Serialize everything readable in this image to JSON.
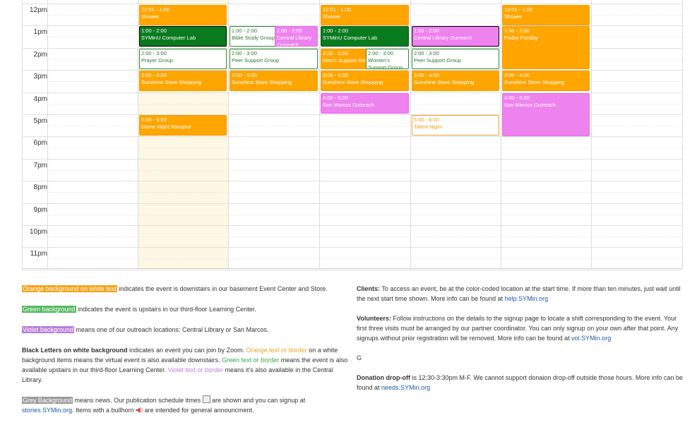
{
  "calendar": {
    "hours": [
      "12pm",
      "1pm",
      "2pm",
      "3pm",
      "4pm",
      "5pm",
      "6pm",
      "7pm",
      "8pm",
      "9pm",
      "10pm",
      "11pm"
    ],
    "events": [
      {
        "id": "e1",
        "day": 1,
        "cls": "orange",
        "time": "12:01 - 1:00",
        "name": "Shower"
      },
      {
        "id": "e2",
        "day": 1,
        "cls": "green",
        "time": "1:00 - 2:00",
        "name": "SYMinU Computer Lab"
      },
      {
        "id": "e3",
        "day": 1,
        "cls": "wgreen",
        "time": "2:00 - 3:00",
        "name": "Prayer Group"
      },
      {
        "id": "e4",
        "day": 1,
        "cls": "orange",
        "time": "3:00 - 4:00",
        "name": "Sunshine Store Shopping"
      },
      {
        "id": "e5",
        "day": 1,
        "cls": "orange",
        "time": "5:00 - 6:00",
        "name": "Game Night Hangout"
      },
      {
        "id": "e6",
        "day": 2,
        "cls": "wgreen",
        "time": "1:00 - 2:00",
        "name": "Bible Study Group"
      },
      {
        "id": "e7",
        "day": 2,
        "cls": "violet",
        "time": "1:00 - 2:00",
        "name": "Central Library Outreach"
      },
      {
        "id": "e8",
        "day": 2,
        "cls": "wgreen",
        "time": "2:00 - 3:00",
        "name": "Peer Support Group"
      },
      {
        "id": "e9",
        "day": 2,
        "cls": "orange",
        "time": "3:00 - 4:00",
        "name": "Sunshine Store Shopping"
      },
      {
        "id": "e10",
        "day": 3,
        "cls": "orange",
        "time": "12:01 - 1:00",
        "name": "Shower"
      },
      {
        "id": "e11",
        "day": 3,
        "cls": "green",
        "time": "1:00 - 2:00",
        "name": "SYMinU Computer Lab"
      },
      {
        "id": "e12",
        "day": 3,
        "cls": "orange",
        "time": "2:00 - 3:00",
        "name": "Men's Support Group"
      },
      {
        "id": "e13",
        "day": 3,
        "cls": "wgreen",
        "time": "2:00 - 3:00",
        "name": "Women's Support Group"
      },
      {
        "id": "e14",
        "day": 3,
        "cls": "orange",
        "time": "3:00 - 4:00",
        "name": "Sunshine Store Shopping"
      },
      {
        "id": "e15",
        "day": 3,
        "cls": "violet",
        "time": "4:00 - 5:00",
        "name": "San Marcos Outreach"
      },
      {
        "id": "e16",
        "day": 4,
        "cls": "violet",
        "time": "1:00 - 2:00",
        "name": "Central Library Outreach"
      },
      {
        "id": "e17",
        "day": 4,
        "cls": "wgreen",
        "time": "2:00 - 3:00",
        "name": "Peer Support Group"
      },
      {
        "id": "e18",
        "day": 4,
        "cls": "orange",
        "time": "3:00 - 4:00",
        "name": "Sunshine Store Shopping"
      },
      {
        "id": "e19",
        "day": 4,
        "cls": "worange",
        "time": "5:00 - 6:00",
        "name": "Talent Night"
      },
      {
        "id": "e20",
        "day": 5,
        "cls": "orange",
        "time": "12:01 - 1:00",
        "name": "Shower"
      },
      {
        "id": "e21",
        "day": 5,
        "cls": "orange",
        "time": "1:00 - 3:00",
        "name": "Friday Funday"
      },
      {
        "id": "e22",
        "day": 5,
        "cls": "orange",
        "time": "3:00 - 4:00",
        "name": "Sunshine Store Shopping"
      },
      {
        "id": "e23",
        "day": 5,
        "cls": "violet",
        "time": "4:00 - 6:00",
        "name": "San Marcos Outreach"
      }
    ]
  },
  "legend": {
    "orange_hl": "Orange background on white text",
    "orange_rest": " indicates the event is downstairs in our basement Event Center and Store.",
    "green_hl": "Green background",
    "green_rest": " indicates the event is upstairs in our third-floor Learning Center.",
    "violet_hl": "Violet background",
    "violet_rest": " means one of our outreach locations: Central Library or San Marcos.",
    "black_bold": "Black Letters on white background",
    "black_rest1": " indicates an event you can join by Zoom. ",
    "orange_txt": "Orange text or border",
    "black_rest2": " on a white background items means the virtual event is also available downstairs. ",
    "green_txt": "Green text or border",
    "black_rest3": " means the event is also available upstairs in our third-floor Learning Center. ",
    "violet_txt": "Violet text or border",
    "black_rest4": " means it's also available in the Central Library.",
    "grey_hl": "Grey Background",
    "grey_rest1": " means news. Our publication schedule itmes ",
    "grey_rest2": " are shown and you can signup at ",
    "grey_link": "stories.SYMin.org",
    "grey_rest3": ". Items with a bullhorn ",
    "grey_rest4": " are intended for general announcment."
  },
  "info": {
    "clients_bold": "Clients:",
    "clients_text": " To access an event, be at the color-coded location at the start time. If more than ten minutes, just wait until the next start time shown. More info can be found at ",
    "clients_link": "help.SYMin.org",
    "vol_bold": "Volunteers:",
    "vol_text": " Follow instructions on the details to the signup page to locate a shift corresponding to the event. Your first three visits must be arranged by our partner coordinator. You can only signup on your own after that point. Any signups without prior registration will be removed. More info can be found at ",
    "vol_link": "vol.SYMin.org",
    "g_letter": "G",
    "don_bold": "Donation drop-off",
    "don_text": " is 12:30-3:30pm M-F. We cannot support donaion drop-off outside those hours. More info can be found at ",
    "don_link": "needs.SYMin.org"
  },
  "colors": {
    "orange": "#ffa500",
    "green": "#0a7a1e",
    "violet": "#ee82ee",
    "today": "#fcf8e3"
  }
}
